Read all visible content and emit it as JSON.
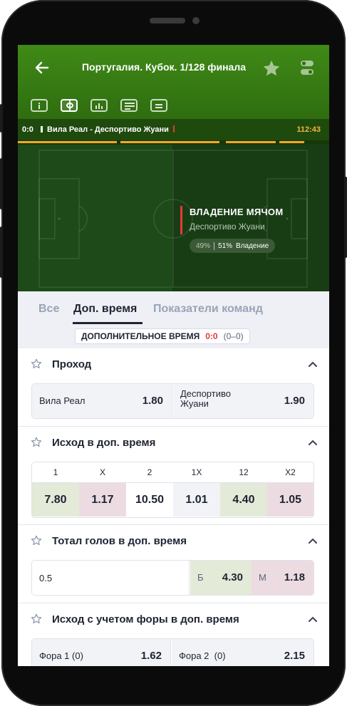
{
  "header": {
    "title": "Португалия. Кубок. 1/128 финала",
    "icons": [
      "back-arrow-icon",
      "star-icon",
      "settings-icon"
    ],
    "tab_icons": [
      "info-icon",
      "field-icon",
      "stats-icon",
      "lineup-icon",
      "bet-slip-icon"
    ]
  },
  "scoreboard": {
    "score": "0:0",
    "teams": "Вила Реал - Деспортиво Жуани",
    "time": "112:43"
  },
  "field_stat": {
    "title": "ВЛАДЕНИЕ МЯЧОМ",
    "team": "Деспортиво Жуани",
    "left_pct": "49%",
    "right_pct": "51%",
    "label": "Владение"
  },
  "subtabs": {
    "all": "Все",
    "extra_time": "Доп. время",
    "team_stats": "Показатели команд"
  },
  "section": {
    "title": "ДОПОЛНИТЕЛЬНОЕ ВРЕМЯ",
    "score": "0:0",
    "sub": "(0–0)"
  },
  "markets": {
    "pass": {
      "title": "Проход",
      "home_label": "Вила Реал",
      "home_odds": "1.80",
      "away_label": "Деспортиво Жуани",
      "away_odds": "1.90"
    },
    "outcome": {
      "title": "Исход в доп. время",
      "headers": [
        "1",
        "X",
        "2",
        "1X",
        "12",
        "X2"
      ],
      "odds": [
        "7.80",
        "1.17",
        "10.50",
        "1.01",
        "4.40",
        "1.05"
      ]
    },
    "total": {
      "title": "Тотал голов в доп. время",
      "line": "0.5",
      "over_label": "Б",
      "over_odds": "4.30",
      "under_label": "М",
      "under_odds": "1.18"
    },
    "handicap": {
      "title": "Исход с учетом форы в доп. время",
      "h1_label": "Фора 1 (0)",
      "h1_odds": "1.62",
      "h2_label": "Фора 2  (0)",
      "h2_odds": "2.15"
    }
  },
  "colors": {
    "header_green": "#3f8a17",
    "accent_orange": "#f6a922",
    "odds_up_green": "#e3ead7",
    "odds_down_red": "#ecdce1",
    "possession_red": "#e53935"
  }
}
